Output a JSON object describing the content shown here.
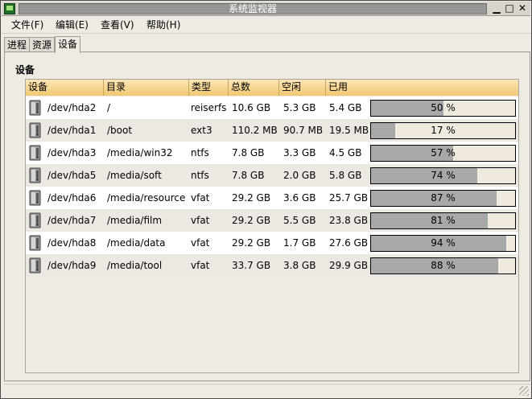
{
  "window": {
    "title": "系统监视器",
    "minimize_glyph": "▁",
    "maximize_glyph": "□",
    "close_glyph": "✕"
  },
  "menu": [
    {
      "label": "文件(F)"
    },
    {
      "label": "编辑(E)"
    },
    {
      "label": "查看(V)"
    },
    {
      "label": "帮助(H)"
    }
  ],
  "tabs": [
    {
      "label": "进程",
      "active": false
    },
    {
      "label": "资源",
      "active": false
    },
    {
      "label": "设备",
      "active": true
    }
  ],
  "devices": {
    "section_title": "设备",
    "columns": [
      "设备",
      "目录",
      "类型",
      "总数",
      "空闲",
      "已用"
    ],
    "rows": [
      {
        "device": "/dev/hda2",
        "dir": "/",
        "type": "reiserfs",
        "total": "10.6 GB",
        "free": "5.3 GB",
        "used": "5.4 GB",
        "percent": 50,
        "percent_label": "50 %"
      },
      {
        "device": "/dev/hda1",
        "dir": "/boot",
        "type": "ext3",
        "total": "110.2 MB",
        "free": "90.7 MB",
        "used": "19.5 MB",
        "percent": 17,
        "percent_label": "17 %"
      },
      {
        "device": "/dev/hda3",
        "dir": "/media/win32",
        "type": "ntfs",
        "total": "7.8 GB",
        "free": "3.3 GB",
        "used": "4.5 GB",
        "percent": 57,
        "percent_label": "57 %"
      },
      {
        "device": "/dev/hda5",
        "dir": "/media/soft",
        "type": "ntfs",
        "total": "7.8 GB",
        "free": "2.0 GB",
        "used": "5.8 GB",
        "percent": 74,
        "percent_label": "74 %"
      },
      {
        "device": "/dev/hda6",
        "dir": "/media/resource",
        "type": "vfat",
        "total": "29.2 GB",
        "free": "3.6 GB",
        "used": "25.7 GB",
        "percent": 87,
        "percent_label": "87 %"
      },
      {
        "device": "/dev/hda7",
        "dir": "/media/film",
        "type": "vfat",
        "total": "29.2 GB",
        "free": "5.5 GB",
        "used": "23.8 GB",
        "percent": 81,
        "percent_label": "81 %"
      },
      {
        "device": "/dev/hda8",
        "dir": "/media/data",
        "type": "vfat",
        "total": "29.2 GB",
        "free": "1.7 GB",
        "used": "27.6 GB",
        "percent": 94,
        "percent_label": "94 %"
      },
      {
        "device": "/dev/hda9",
        "dir": "/media/tool",
        "type": "vfat",
        "total": "33.7 GB",
        "free": "3.8 GB",
        "used": "29.9 GB",
        "percent": 88,
        "percent_label": "88 %"
      }
    ]
  },
  "colors": {
    "header_bg": "#f7d89a",
    "bar_fill": "#a8a8a8",
    "row_alt": "#ede9e2"
  },
  "icons": {
    "disk": "hard-disk-icon"
  }
}
